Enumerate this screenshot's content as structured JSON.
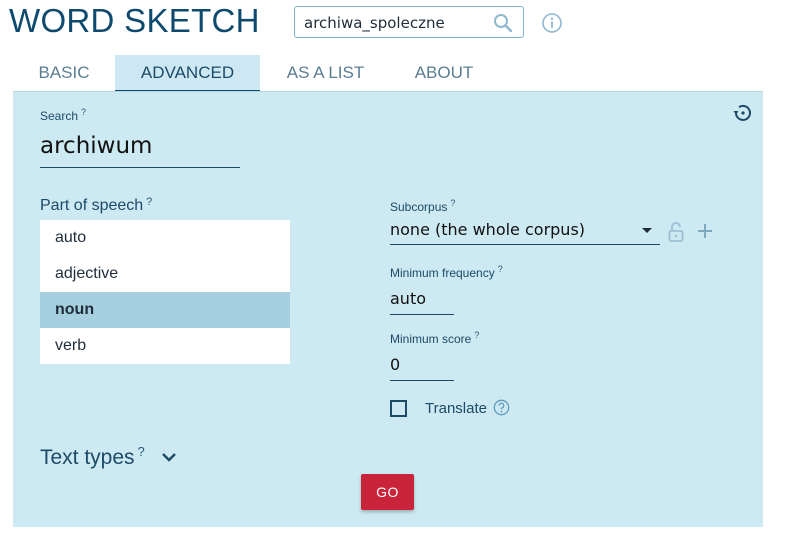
{
  "app": {
    "title": "WORD SKETCH"
  },
  "corpus_selector": {
    "value": "archiwa_spoleczne"
  },
  "tabs": [
    {
      "label": "BASIC",
      "active": false
    },
    {
      "label": "ADVANCED",
      "active": true
    },
    {
      "label": "AS A LIST",
      "active": false
    },
    {
      "label": "ABOUT",
      "active": false
    }
  ],
  "form": {
    "search": {
      "label": "Search",
      "help": "?",
      "value": "archiwum"
    },
    "part_of_speech": {
      "label": "Part of speech",
      "help": "?",
      "options": [
        "auto",
        "adjective",
        "noun",
        "verb"
      ],
      "selected": "noun"
    },
    "subcorpus": {
      "label": "Subcorpus",
      "help": "?",
      "value": "none (the whole corpus)"
    },
    "minimum_frequency": {
      "label": "Minimum frequency",
      "help": "?",
      "value": "auto"
    },
    "minimum_score": {
      "label": "Minimum score",
      "help": "?",
      "value": "0"
    },
    "translate": {
      "label": "Translate",
      "checked": false
    },
    "text_types": {
      "label": "Text types",
      "help": "?"
    },
    "go_label": "GO"
  },
  "icons": {
    "search": "search-icon",
    "info": "info-icon",
    "history": "history-icon",
    "lock": "lock-icon",
    "plus": "plus-icon",
    "help": "help-icon",
    "chevron": "chevron-down-icon"
  },
  "colors": {
    "accent": "#c8243a",
    "panel": "#cde9f2",
    "brand": "#0e4a6e"
  }
}
